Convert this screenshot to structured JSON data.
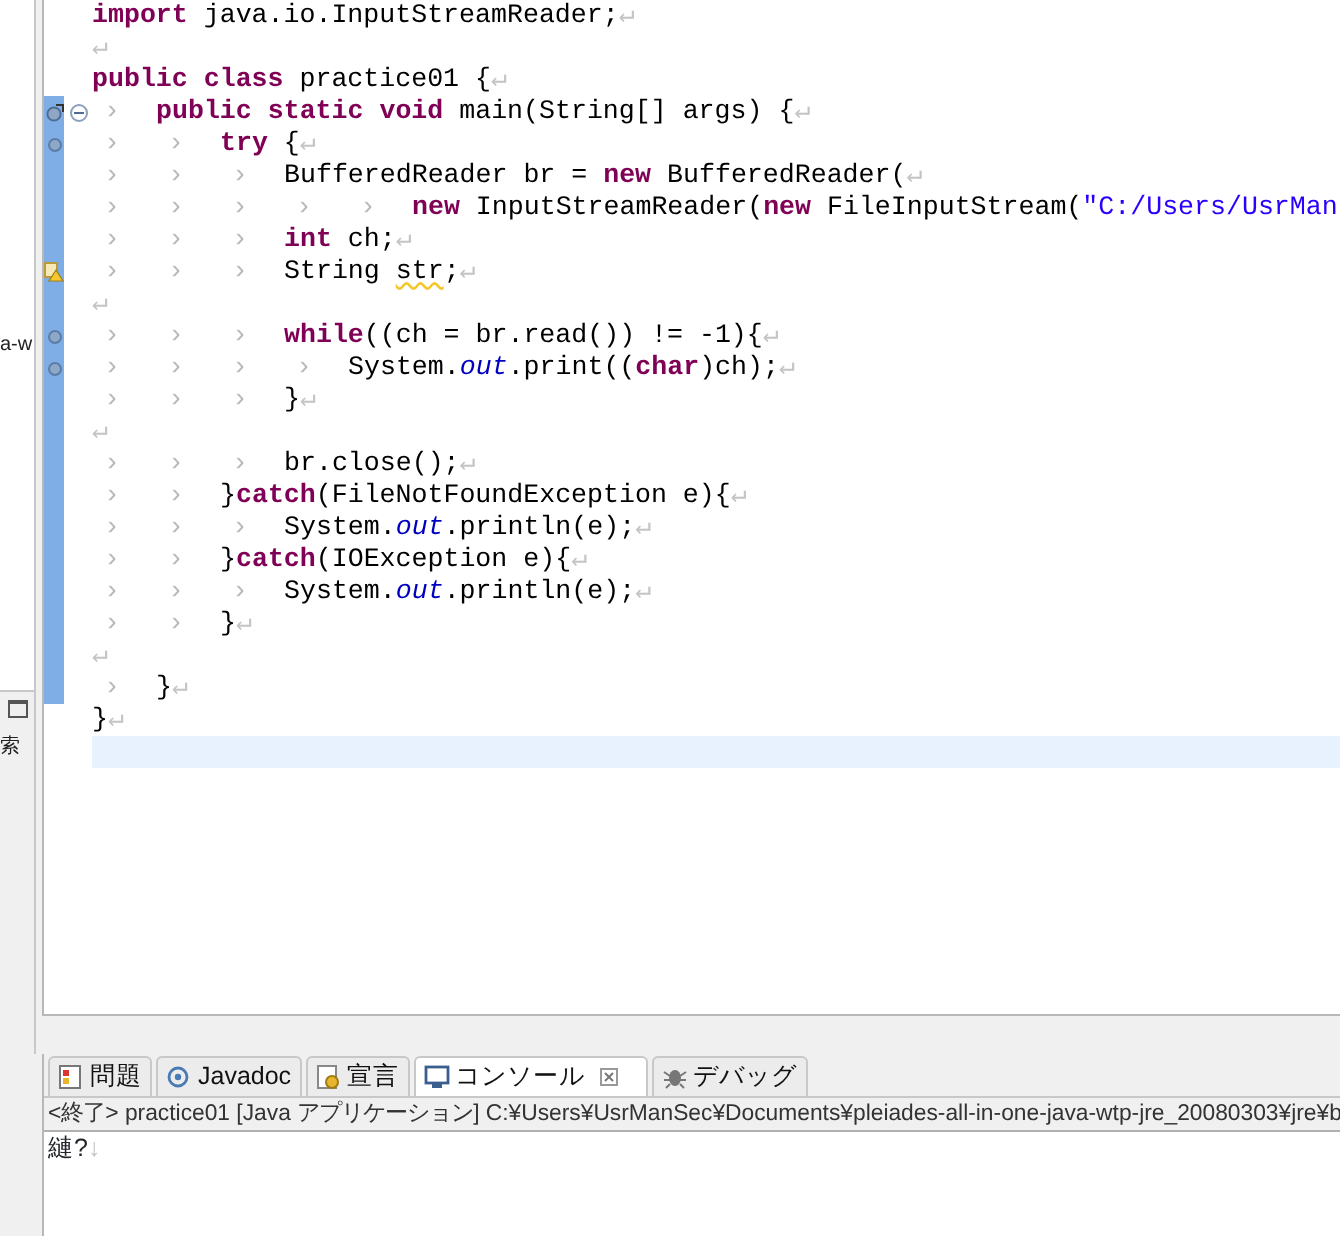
{
  "side_panel": {
    "clipped_label": "a-w",
    "search_label": "索"
  },
  "editor": {
    "lines": [
      {
        "kind": "plain",
        "range": false,
        "current": false,
        "fold": false,
        "segments": [
          {
            "kind": "kw",
            "text": "import"
          },
          {
            "kind": "plain",
            "text": " java.io.InputStreamReader;"
          }
        ],
        "eol": "↵"
      },
      {
        "kind": "plain",
        "range": false,
        "current": false,
        "fold": false,
        "eol": "↵"
      },
      {
        "kind": "plain",
        "range": false,
        "current": false,
        "fold": false,
        "segments": [
          {
            "kind": "kw",
            "text": "public class"
          },
          {
            "kind": "plain",
            "text": " practice01 {"
          }
        ],
        "eol": "↵"
      },
      {
        "kind": "override",
        "range": true,
        "current": false,
        "fold": true,
        "segments": [
          {
            "kind": "tab",
            "text": "›"
          },
          {
            "kind": "kw",
            "text": "public static void"
          },
          {
            "kind": "plain",
            "text": " main(String[] args) {"
          }
        ],
        "eol": "↵"
      },
      {
        "kind": "occurrence",
        "range": true,
        "current": false,
        "fold": false,
        "segments": [
          {
            "kind": "tab",
            "text": "›"
          },
          {
            "kind": "tab",
            "text": "›"
          },
          {
            "kind": "kw",
            "text": "try"
          },
          {
            "kind": "plain",
            "text": " {"
          }
        ],
        "eol": "↵"
      },
      {
        "kind": "plain",
        "range": true,
        "current": false,
        "fold": false,
        "segments": [
          {
            "kind": "tab",
            "text": "›"
          },
          {
            "kind": "tab",
            "text": "›"
          },
          {
            "kind": "tab",
            "text": "›"
          },
          {
            "kind": "plain",
            "text": "BufferedReader br = "
          },
          {
            "kind": "kw",
            "text": "new"
          },
          {
            "kind": "plain",
            "text": " BufferedReader("
          }
        ],
        "eol": "↵"
      },
      {
        "kind": "plain",
        "range": true,
        "current": false,
        "fold": false,
        "segments": [
          {
            "kind": "tab",
            "text": "›"
          },
          {
            "kind": "tab",
            "text": "›"
          },
          {
            "kind": "tab",
            "text": "›"
          },
          {
            "kind": "tab",
            "text": "›"
          },
          {
            "kind": "tab",
            "text": "›"
          },
          {
            "kind": "kw",
            "text": "new"
          },
          {
            "kind": "plain",
            "text": " InputStreamReader("
          },
          {
            "kind": "kw",
            "text": "new"
          },
          {
            "kind": "plain",
            "text": " FileInputStream("
          },
          {
            "kind": "string",
            "text": "\"C:/Users/UsrMan"
          }
        ]
      },
      {
        "kind": "plain",
        "range": true,
        "current": false,
        "fold": false,
        "segments": [
          {
            "kind": "tab",
            "text": "›"
          },
          {
            "kind": "tab",
            "text": "›"
          },
          {
            "kind": "tab",
            "text": "›"
          },
          {
            "kind": "kw",
            "text": "int"
          },
          {
            "kind": "plain",
            "text": " ch;"
          }
        ],
        "eol": "↵"
      },
      {
        "kind": "warning",
        "range": true,
        "current": false,
        "fold": false,
        "segments": [
          {
            "kind": "tab",
            "text": "›"
          },
          {
            "kind": "tab",
            "text": "›"
          },
          {
            "kind": "tab",
            "text": "›"
          },
          {
            "kind": "plain",
            "text": "String "
          },
          {
            "kind": "warn",
            "text": "str"
          },
          {
            "kind": "plain",
            "text": ";"
          }
        ],
        "eol": "↵"
      },
      {
        "kind": "plain",
        "range": true,
        "current": false,
        "fold": false,
        "eol": "↵"
      },
      {
        "kind": "occurrence",
        "range": true,
        "current": false,
        "fold": false,
        "segments": [
          {
            "kind": "tab",
            "text": "›"
          },
          {
            "kind": "tab",
            "text": "›"
          },
          {
            "kind": "tab",
            "text": "›"
          },
          {
            "kind": "kw",
            "text": "while"
          },
          {
            "kind": "plain",
            "text": "((ch = br.read()) != -1){"
          }
        ],
        "eol": "↵"
      },
      {
        "kind": "occurrence",
        "range": true,
        "current": false,
        "fold": false,
        "segments": [
          {
            "kind": "tab",
            "text": "›"
          },
          {
            "kind": "tab",
            "text": "›"
          },
          {
            "kind": "tab",
            "text": "›"
          },
          {
            "kind": "tab",
            "text": "›"
          },
          {
            "kind": "plain",
            "text": "System."
          },
          {
            "kind": "field",
            "text": "out"
          },
          {
            "kind": "plain",
            "text": ".print(("
          },
          {
            "kind": "kw",
            "text": "char"
          },
          {
            "kind": "plain",
            "text": ")ch);"
          }
        ],
        "eol": "↵"
      },
      {
        "kind": "plain",
        "range": true,
        "current": false,
        "fold": false,
        "segments": [
          {
            "kind": "tab",
            "text": "›"
          },
          {
            "kind": "tab",
            "text": "›"
          },
          {
            "kind": "tab",
            "text": "›"
          },
          {
            "kind": "plain",
            "text": "}"
          }
        ],
        "eol": "↵"
      },
      {
        "kind": "plain",
        "range": true,
        "current": false,
        "fold": false,
        "eol": "↵"
      },
      {
        "kind": "plain",
        "range": true,
        "current": false,
        "fold": false,
        "segments": [
          {
            "kind": "tab",
            "text": "›"
          },
          {
            "kind": "tab",
            "text": "›"
          },
          {
            "kind": "tab",
            "text": "›"
          },
          {
            "kind": "plain",
            "text": "br.close();"
          }
        ],
        "eol": "↵"
      },
      {
        "kind": "plain",
        "range": true,
        "current": false,
        "fold": false,
        "segments": [
          {
            "kind": "tab",
            "text": "›"
          },
          {
            "kind": "tab",
            "text": "›"
          },
          {
            "kind": "plain",
            "text": "}"
          },
          {
            "kind": "kw",
            "text": "catch"
          },
          {
            "kind": "plain",
            "text": "(FileNotFoundException e){"
          }
        ],
        "eol": "↵"
      },
      {
        "kind": "plain",
        "range": true,
        "current": false,
        "fold": false,
        "segments": [
          {
            "kind": "tab",
            "text": "›"
          },
          {
            "kind": "tab",
            "text": "›"
          },
          {
            "kind": "tab",
            "text": "›"
          },
          {
            "kind": "plain",
            "text": "System."
          },
          {
            "kind": "field",
            "text": "out"
          },
          {
            "kind": "plain",
            "text": ".println(e);"
          }
        ],
        "eol": "↵"
      },
      {
        "kind": "plain",
        "range": true,
        "current": false,
        "fold": false,
        "segments": [
          {
            "kind": "tab",
            "text": "›"
          },
          {
            "kind": "tab",
            "text": "›"
          },
          {
            "kind": "plain",
            "text": "}"
          },
          {
            "kind": "kw",
            "text": "catch"
          },
          {
            "kind": "plain",
            "text": "(IOException e){"
          }
        ],
        "eol": "↵"
      },
      {
        "kind": "plain",
        "range": true,
        "current": false,
        "fold": false,
        "segments": [
          {
            "kind": "tab",
            "text": "›"
          },
          {
            "kind": "tab",
            "text": "›"
          },
          {
            "kind": "tab",
            "text": "›"
          },
          {
            "kind": "plain",
            "text": "System."
          },
          {
            "kind": "field",
            "text": "out"
          },
          {
            "kind": "plain",
            "text": ".println(e);"
          }
        ],
        "eol": "↵"
      },
      {
        "kind": "plain",
        "range": true,
        "current": false,
        "fold": false,
        "segments": [
          {
            "kind": "tab",
            "text": "›"
          },
          {
            "kind": "tab",
            "text": "›"
          },
          {
            "kind": "plain",
            "text": "}"
          }
        ],
        "eol": "↵"
      },
      {
        "kind": "plain",
        "range": true,
        "current": false,
        "fold": false,
        "eol": "↵"
      },
      {
        "kind": "plain",
        "range": true,
        "current": false,
        "fold": false,
        "segments": [
          {
            "kind": "tab",
            "text": "›"
          },
          {
            "kind": "plain",
            "text": "}"
          }
        ],
        "eol": "↵"
      },
      {
        "kind": "plain",
        "range": false,
        "current": false,
        "fold": false,
        "segments": [
          {
            "kind": "plain",
            "text": "}"
          }
        ],
        "eol": "↵"
      },
      {
        "kind": "plain",
        "range": false,
        "current": true,
        "fold": false
      }
    ]
  },
  "bottom_panel": {
    "tabs": [
      {
        "label": "問題",
        "selected": false,
        "closable": false
      },
      {
        "label": "Javadoc",
        "selected": false,
        "closable": false
      },
      {
        "label": "宣言",
        "selected": false,
        "closable": false
      },
      {
        "label": "コンソール",
        "selected": true,
        "closable": true
      },
      {
        "label": "デバッグ",
        "selected": false,
        "closable": false
      }
    ],
    "console_header": "<終了> practice01 [Java アプリケーション] C:¥Users¥UsrManSec¥Documents¥pleiades-all-in-one-java-wtp-jre_20080303¥jre¥b",
    "output": [
      {
        "text": "縺?",
        "eol": "↓"
      }
    ]
  }
}
